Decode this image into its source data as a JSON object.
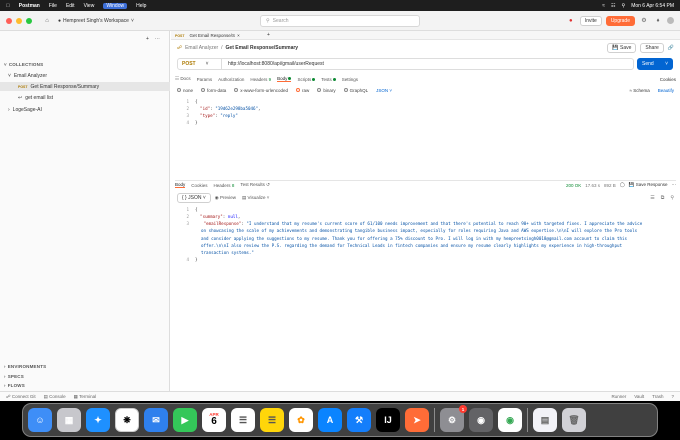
{
  "menubar": {
    "app": "Postman",
    "items": [
      "File",
      "Edit",
      "View",
      "Window",
      "Help"
    ],
    "active_item": "Window",
    "clock": "Mon 6 Apr 6:54 PM"
  },
  "titlebar": {
    "workspace": "Hempreet Singh's Workspace",
    "search_placeholder": "Search",
    "invite": "Invite",
    "upgrade": "Upgrade"
  },
  "sidebar": {
    "collections_header": "COLLECTIONS",
    "items": [
      {
        "label": "Email Analyzer"
      },
      {
        "method": "POST",
        "label": "Get Email Response/Summary"
      },
      {
        "label": "get email list"
      },
      {
        "label": "LogeSage-AI"
      }
    ],
    "footer_sections": [
      "ENVIRONMENTS",
      "SPECS",
      "FLOWS"
    ]
  },
  "tabs": {
    "open_tab_method": "POST",
    "open_tab_label": "Get Email Response/S"
  },
  "request": {
    "breadcrumb_parent": "Email Analyzer",
    "breadcrumb_sep": "/",
    "title": "Get Email Response/Summary",
    "save": "Save",
    "share": "Share",
    "method": "POST",
    "url": "http://localhost:8080/api/gmail/userRequest",
    "send": "Send",
    "subtabs": [
      "Docs",
      "Params",
      "Authorization",
      "Headers",
      "Body",
      "Scripts",
      "Tests",
      "Settings"
    ],
    "headers_count": "9",
    "active_subtab": "Body",
    "cookies": "Cookies",
    "body_types": [
      "none",
      "form-data",
      "x-www-form-urlencoded",
      "raw",
      "binary",
      "GraphQL"
    ],
    "selected_body_type": "raw",
    "format": "JSON",
    "schema": "Schema",
    "beautify": "Beautify",
    "body_lines": [
      {
        "n": "1",
        "text": "{"
      },
      {
        "n": "2",
        "key": "\"id\"",
        "val": "\"19d62e298ba5046\""
      },
      {
        "n": "3",
        "key": "\"type\"",
        "val": "\"reply\""
      },
      {
        "n": "4",
        "text": "}"
      }
    ]
  },
  "response": {
    "tabs": [
      "Body",
      "Cookies",
      "Headers",
      "Test Results"
    ],
    "headers_count": "8",
    "status": "200 OK",
    "time": "17.63 s",
    "size": "892 B",
    "save_response": "Save Response",
    "format": "JSON",
    "preview": "Preview",
    "visualize": "Visualize",
    "lines": [
      {
        "n": "1",
        "text": "{"
      },
      {
        "n": "2",
        "key": "\"summary\"",
        "val": "null"
      },
      {
        "n": "3",
        "key": "\"emailResponse\"",
        "val": "\"I understand that my resume's current score of 61/100 needs improvement and that there's potential to reach 90+ with targeted fixes. I appreciate the advice on showcasing the scale of my achievements and demonstrating tangible business impact, especially for roles requiring Java and AWS expertise.\\n\\nI will explore the Pro tools and consider applying the suggestions to my resume. Thank you for offering a 75% discount to Pro. I will log in with my hempreetsingh0018@gmail.com account to claim this offer.\\n\\nI also review the P.S. regarding the demand for Technical Leads in fintech companies and ensure my resume clearly highlights my experience in high-throughput transaction systems.\""
      },
      {
        "n": "4",
        "text": "}"
      }
    ]
  },
  "statusbar": {
    "items": [
      "Connect Git",
      "Console",
      "Terminal"
    ],
    "right_items": [
      "Runner",
      "Vault",
      "Trash"
    ]
  },
  "dock": {
    "apps": [
      "finder-icon",
      "launchpad-icon",
      "safari-icon",
      "chatgpt-icon",
      "mail-icon",
      "facetime-icon",
      "calendar-icon",
      "reminders-icon",
      "notes-icon",
      "photos-icon",
      "appstore-icon",
      "xcode-icon",
      "intellij-icon",
      "postman-icon",
      "settings-icon",
      "disk-utility-icon",
      "chrome-icon",
      "document-icon",
      "trash-icon"
    ],
    "calendar_month": "APR",
    "calendar_day": "6",
    "settings_badge": "1"
  }
}
